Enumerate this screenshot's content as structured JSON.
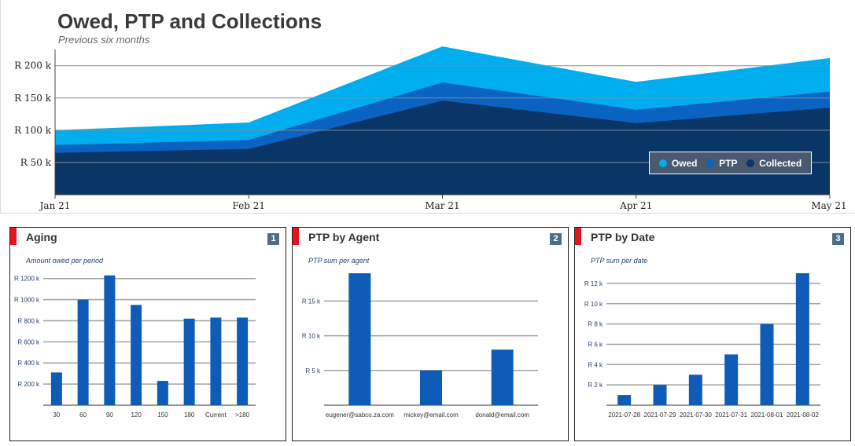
{
  "main": {
    "title": "Owed, PTP and Collections",
    "subtitle": "Previous six months",
    "legend": [
      {
        "name": "Owed",
        "color": "#00aeef"
      },
      {
        "name": "PTP",
        "color": "#0a63c0"
      },
      {
        "name": "Collected",
        "color": "#0a3567"
      }
    ]
  },
  "panels": [
    {
      "title": "Aging",
      "number": "1",
      "subtitle": "Amount owed per period"
    },
    {
      "title": "PTP by Agent",
      "number": "2",
      "subtitle": "PTP sum per agent"
    },
    {
      "title": "PTP by Date",
      "number": "3",
      "subtitle": "PTP sum per date"
    }
  ],
  "chart_data": [
    {
      "type": "area",
      "title": "Owed, PTP and Collections",
      "subtitle": "Previous six months",
      "x": [
        "Jan 21",
        "Feb 21",
        "Mar 21",
        "Apr 21",
        "May 21"
      ],
      "yticks": [
        "R 50 k",
        "R 100 k",
        "R 150 k",
        "R 200 k"
      ],
      "ytick_values": [
        50000,
        100000,
        150000,
        200000
      ],
      "ylim": [
        0,
        235000
      ],
      "series": [
        {
          "name": "Owed",
          "color": "#00aeef",
          "values": [
            100000,
            112000,
            230000,
            175000,
            212000
          ]
        },
        {
          "name": "PTP",
          "color": "#0a63c0",
          "values": [
            77000,
            85000,
            174000,
            132000,
            160000
          ]
        },
        {
          "name": "Collected",
          "color": "#0a3567",
          "values": [
            65000,
            71000,
            146000,
            111000,
            135000
          ]
        }
      ],
      "grid": true,
      "legend": "bottom-right"
    },
    {
      "type": "bar",
      "title": "Aging",
      "subtitle": "Amount owed per period",
      "categories": [
        "30",
        "60",
        "90",
        "120",
        "150",
        "180",
        "Current",
        ">180"
      ],
      "values": [
        310000,
        1000000,
        1230000,
        950000,
        230000,
        820000,
        830000,
        830000
      ],
      "yticks": [
        "R 200 k",
        "R 400 k",
        "R 600 k",
        "R 800 k",
        "R 1000 k",
        "R 1200 k"
      ],
      "ytick_values": [
        200000,
        400000,
        600000,
        800000,
        1000000,
        1200000
      ],
      "ylim": [
        0,
        1250000
      ],
      "color": "#0f5cb8"
    },
    {
      "type": "bar",
      "title": "PTP by Agent",
      "subtitle": "PTP sum per agent",
      "categories": [
        "eugener@sabco.za.com",
        "mickey@email.com",
        "donald@email.com"
      ],
      "values": [
        19000,
        5000,
        8000
      ],
      "yticks": [
        "R 5 k",
        "R 10 k",
        "R 15 k"
      ],
      "ytick_values": [
        5000,
        10000,
        15000
      ],
      "ylim": [
        0,
        19000
      ],
      "color": "#0f5cb8"
    },
    {
      "type": "bar",
      "title": "PTP by Date",
      "subtitle": "PTP sum per date",
      "categories": [
        "2021-07-28",
        "2021-07-29",
        "2021-07-30",
        "2021-07-31",
        "2021-08-01",
        "2021-08-02"
      ],
      "values": [
        1000,
        2000,
        3000,
        5000,
        8000,
        13000
      ],
      "yticks": [
        "R 2 k",
        "R 4 k",
        "R 6 k",
        "R 8 k",
        "R 10 k",
        "R 12 k"
      ],
      "ytick_values": [
        2000,
        4000,
        6000,
        8000,
        10000,
        12000
      ],
      "ylim": [
        0,
        13000
      ],
      "color": "#0f5cb8"
    }
  ]
}
